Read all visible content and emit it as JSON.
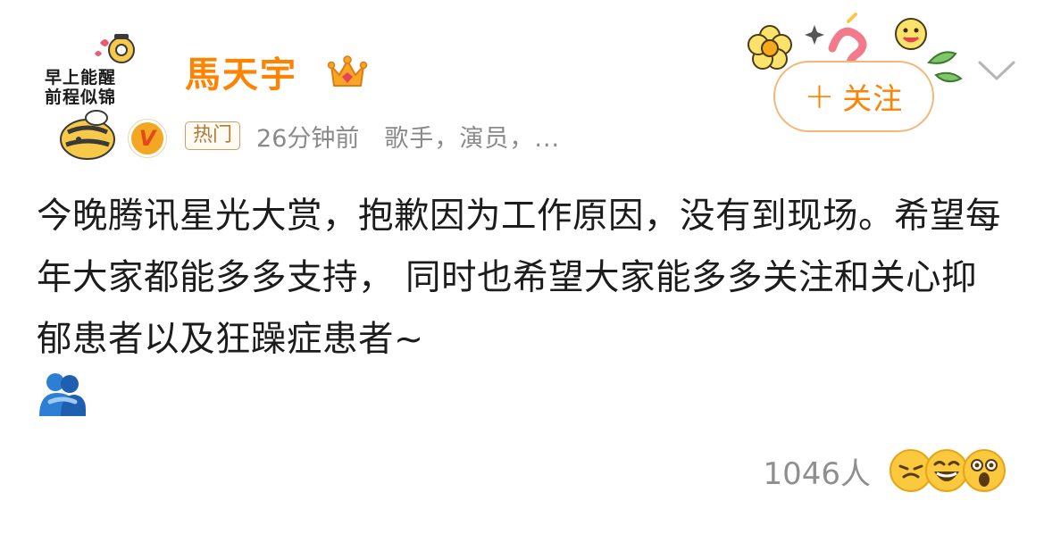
{
  "user": {
    "name": "馬天宇",
    "avatar_lines": [
      "早上能醒",
      "前程似锦"
    ],
    "verified_mark": "V"
  },
  "meta": {
    "tag": "热门",
    "time": "26分钟前",
    "description": "歌手，演员，..."
  },
  "follow": {
    "plus": "+",
    "label": "关注"
  },
  "post": {
    "text": "今晚腾讯星光大赏，抱歉因为工作原因，没有到现场。希望每年大家都能多多支持， 同时也希望大家能多多关注和关心抑郁患者以及狂躁症患者~"
  },
  "reactions": {
    "count": "1046人",
    "emojis": [
      "grin-face-icon",
      "laughing-face-icon",
      "surprised-face-icon"
    ]
  },
  "colors": {
    "accent": "#ff8200",
    "follow_border": "#f4b778",
    "meta_gray": "#8a8a8a",
    "text": "#1c1c1c"
  }
}
